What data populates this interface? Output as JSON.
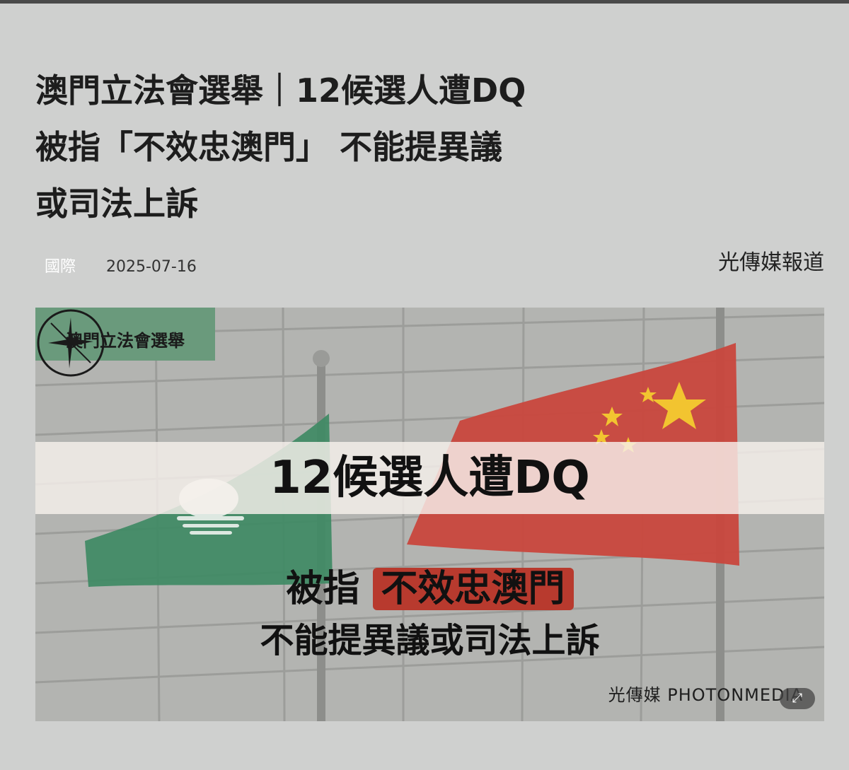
{
  "article": {
    "headline_lines": [
      "澳門立法會選舉｜12候選人遭DQ",
      "被指「不效忠澳門」 不能提異議",
      "或司法上訴"
    ],
    "category": "國際",
    "date": "2025-07-16",
    "source": "光傳媒報道"
  },
  "hero_image": {
    "tag": "澳門立法會選舉",
    "band_title": "12候選人遭DQ",
    "line2_prefix": "被指",
    "line2_highlight": "不效忠澳門",
    "line3": "不能提異議或司法上訴",
    "watermark": "光傳媒 PHOTONMEDIA",
    "expand_icon": "expand-icon"
  },
  "colors": {
    "background": "#cfd0cf",
    "headline": "#1d1d1d",
    "tag_green": "#6a9a7c",
    "highlight_red": "#b83a2e",
    "flag_red": "#c9473d",
    "macau_green": "#3f8a64"
  }
}
